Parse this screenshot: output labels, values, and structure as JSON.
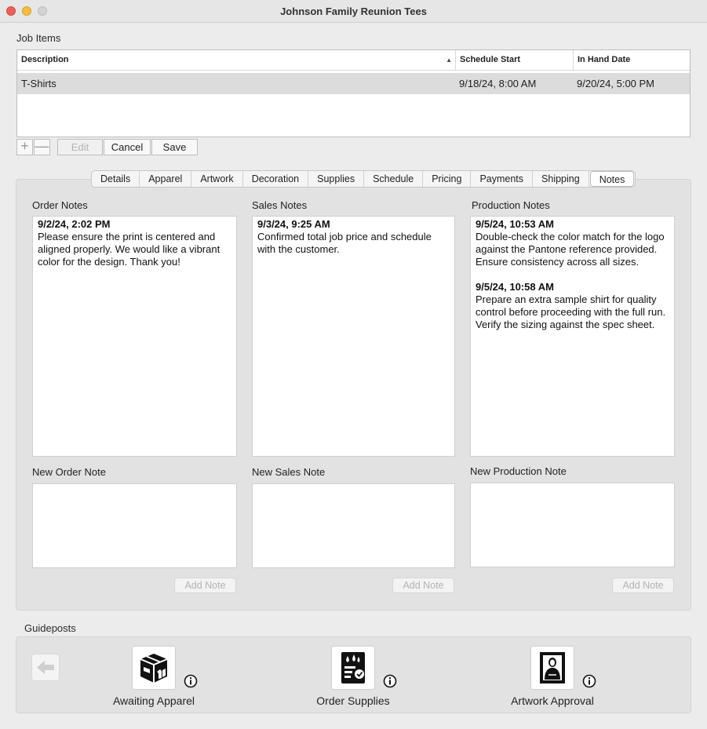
{
  "window": {
    "title": "Johnson Family Reunion Tees"
  },
  "job_items": {
    "label": "Job Items",
    "columns": [
      "Description",
      "Schedule Start",
      "In Hand Date"
    ],
    "rows": [
      {
        "description": "T-Shirts",
        "schedule_start": "9/18/24, 8:00 AM",
        "in_hand": "9/20/24, 5:00 PM"
      }
    ],
    "buttons": {
      "add": "+",
      "remove": "—",
      "edit": "Edit",
      "cancel": "Cancel",
      "save": "Save"
    }
  },
  "tabs": [
    "Details",
    "Apparel",
    "Artwork",
    "Decoration",
    "Supplies",
    "Schedule",
    "Pricing",
    "Payments",
    "Shipping",
    "Notes"
  ],
  "active_tab": "Notes",
  "notes": {
    "order": {
      "label": "Order Notes",
      "entries": [
        {
          "time": "9/2/24, 2:02 PM",
          "text": "Please ensure the print is centered and aligned properly. We would like a vibrant color for the design. Thank you!"
        }
      ],
      "new_label": "New Order Note"
    },
    "sales": {
      "label": "Sales Notes",
      "entries": [
        {
          "time": "9/3/24, 9:25 AM",
          "text": "Confirmed total job price and schedule with the customer."
        }
      ],
      "new_label": "New Sales Note"
    },
    "production": {
      "label": "Production Notes",
      "entries": [
        {
          "time": "9/5/24, 10:53 AM",
          "text": "Double-check the color match for the logo against the Pantone reference provided. Ensure consistency across all sizes."
        },
        {
          "time": "9/5/24, 10:58 AM",
          "text": "Prepare an extra sample shirt for quality control before proceeding with the full run. Verify the sizing against the spec sheet."
        }
      ],
      "new_label": "New Production Note"
    },
    "add_note_label": "Add Note"
  },
  "guideposts": {
    "label": "Guideposts",
    "items": [
      {
        "label": "Awaiting Apparel",
        "icon": "apparel-box-icon"
      },
      {
        "label": "Order Supplies",
        "icon": "ink-supplies-icon"
      },
      {
        "label": "Artwork Approval",
        "icon": "framed-portrait-icon"
      }
    ]
  }
}
